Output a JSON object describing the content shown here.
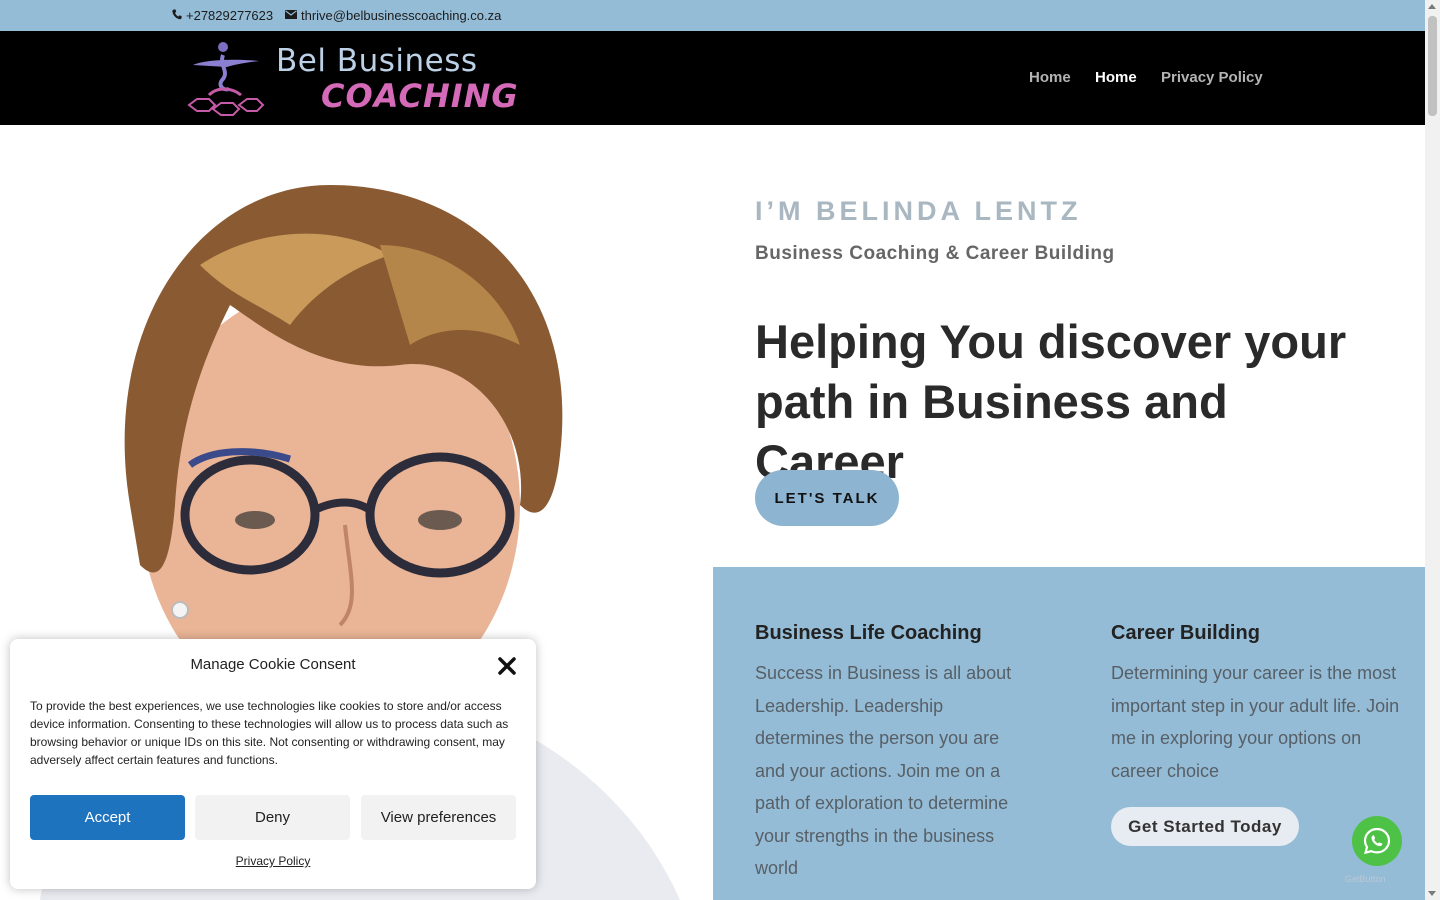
{
  "topbar": {
    "phone": "+27829277623",
    "email": "thrive@belbusinesscoaching.co.za"
  },
  "header": {
    "logo_line1": "Bel Business",
    "logo_line2": "COACHING",
    "nav": [
      {
        "label": "Home",
        "active": false
      },
      {
        "label": "Home",
        "active": true
      },
      {
        "label": "Privacy Policy",
        "active": false
      }
    ]
  },
  "hero": {
    "pre": "I’M BELINDA LENTZ",
    "sub": "Business Coaching & Career Building",
    "title": "Helping You discover your path in Business and Career",
    "cta": "LET'S TALK"
  },
  "services": [
    {
      "title": "Business Life Coaching",
      "body": "Success in Business is all about Leadership. Leadership determines the person you are and your actions. Join me on a path of exploration to determine your strengths in the business world"
    },
    {
      "title": "Career Building",
      "body": "Determining your career is the most important step in your adult life. Join me in exploring your options on career choice",
      "cta": "Get Started Today"
    }
  ],
  "cookie": {
    "title": "Manage Cookie Consent",
    "text": "To provide the best experiences, we use technologies like cookies to store and/or access device information. Consenting to these technologies will allow us to process data such as browsing behavior or unique IDs on this site. Not consenting or withdrawing consent, may adversely affect certain features and functions.",
    "accept": "Accept",
    "deny": "Deny",
    "preferences": "View preferences",
    "policy_link": "Privacy Policy"
  },
  "whatsapp": {
    "tag": "GetButton"
  },
  "colors": {
    "topbar": "#95bcd6",
    "header": "#000000",
    "accent_button": "#1e73be",
    "panel": "#95bcd6",
    "whatsapp": "#4dc247"
  }
}
